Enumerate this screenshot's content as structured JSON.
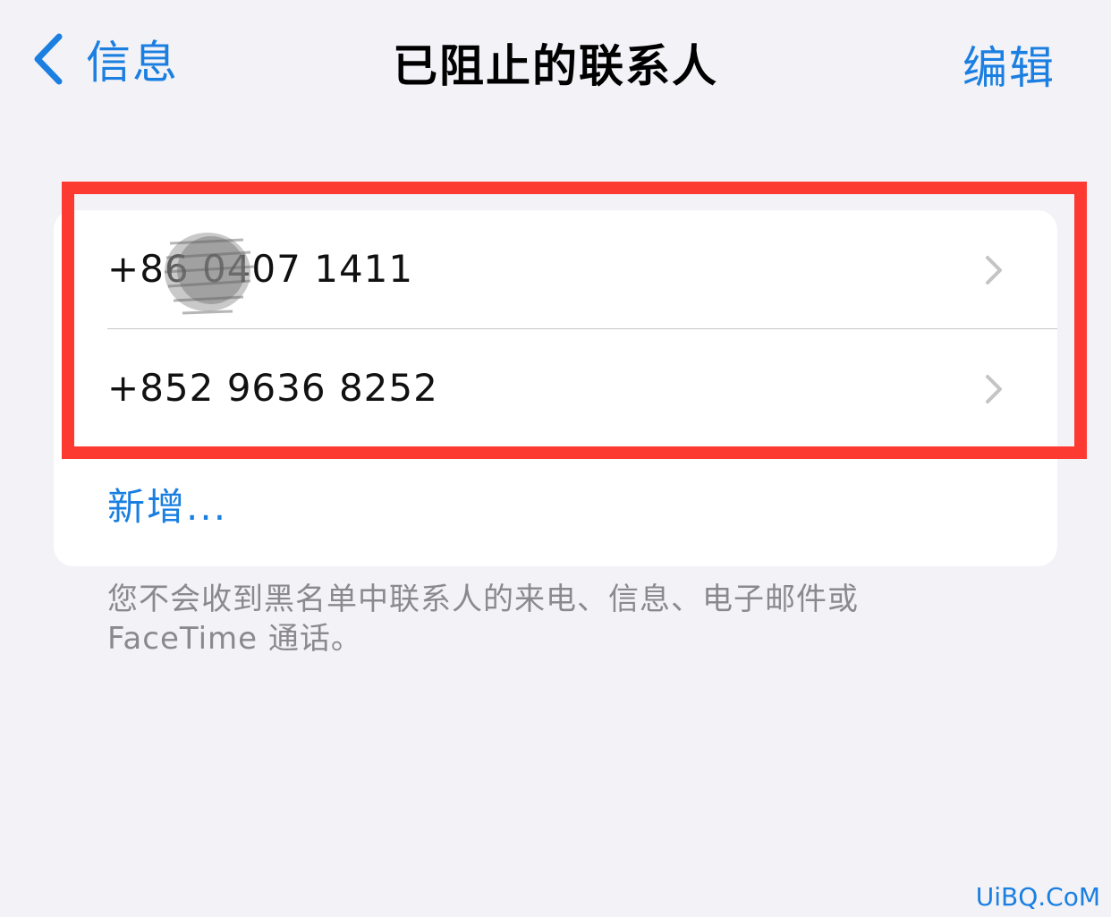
{
  "nav": {
    "back_label": "信息",
    "title": "已阻止的联系人",
    "edit_label": "编辑"
  },
  "blocked_contacts": [
    {
      "number": "+86 0407 1411"
    },
    {
      "number": "+852 9636 8252"
    }
  ],
  "add_label": "新增...",
  "footer_text": "您不会收到黑名单中联系人的来电、信息、电子邮件或FaceTime 通话。",
  "watermark": "UiBQ.CoM",
  "colors": {
    "accent": "#1a7fe0",
    "background": "#f2f2f7",
    "highlight": "#fd3a31"
  },
  "icons": {
    "back": "chevron-left-icon",
    "row": "chevron-right-icon"
  }
}
